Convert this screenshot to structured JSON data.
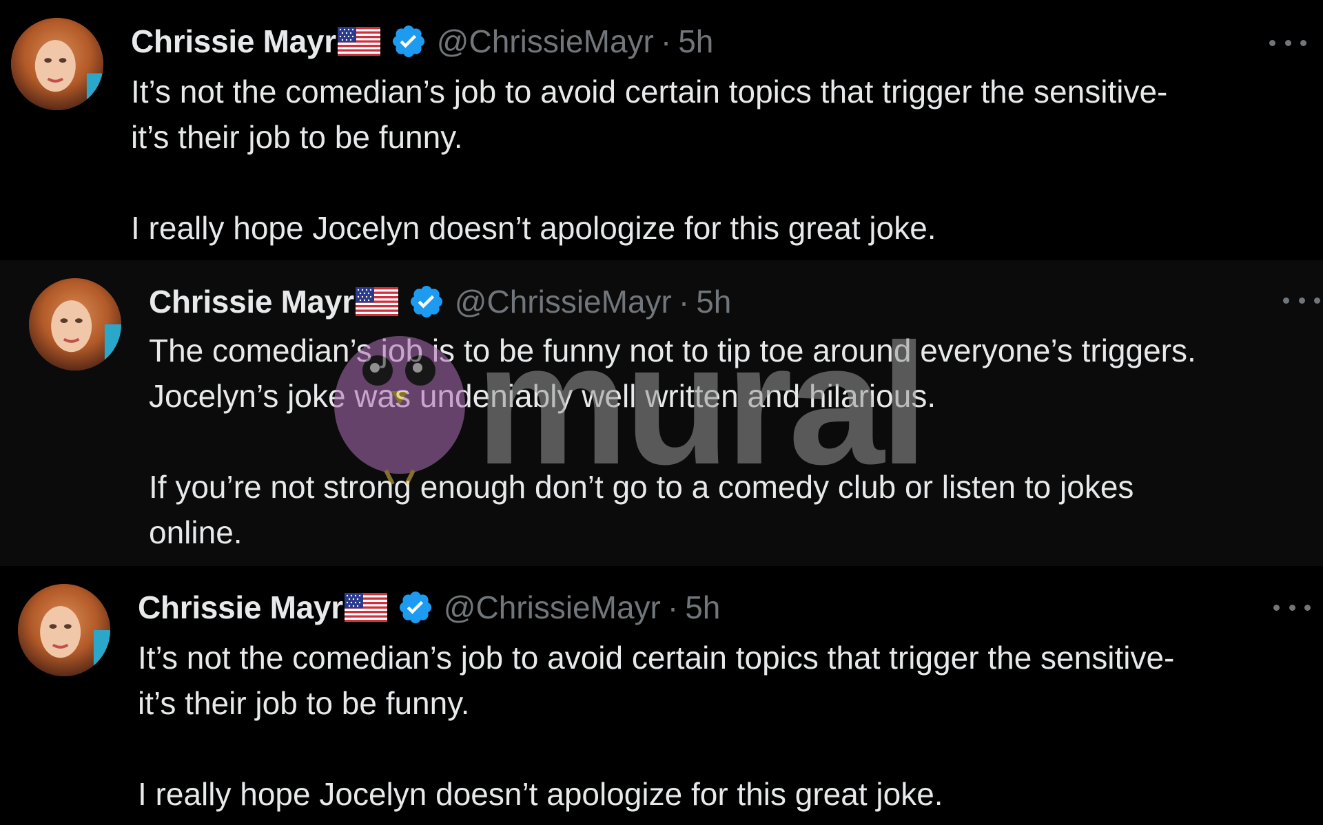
{
  "tweets": [
    {
      "display_name": "Chrissie Mayr",
      "flag_icon": "us-flag-icon",
      "verified_icon": "verified-badge-icon",
      "handle": "@ChrissieMayr",
      "separator": "·",
      "time": "5h",
      "body_lines": [
        "It’s not the comedian’s job to avoid certain topics that trigger the sensitive-",
        "it’s their job to be funny.",
        "",
        "I really hope Jocelyn doesn’t apologize for this great joke."
      ]
    },
    {
      "display_name": "Chrissie Mayr",
      "flag_icon": "us-flag-icon",
      "verified_icon": "verified-badge-icon",
      "handle": "@ChrissieMayr",
      "separator": "·",
      "time": "5h",
      "body_lines": [
        "The comedian’s job is to be funny not to tip toe around everyone’s triggers.",
        "Jocelyn’s joke was undeniably well written and hilarious.",
        "",
        "If you’re not strong enough don’t go to a comedy club or listen to jokes",
        "online."
      ]
    },
    {
      "display_name": "Chrissie Mayr",
      "flag_icon": "us-flag-icon",
      "verified_icon": "verified-badge-icon",
      "handle": "@ChrissieMayr",
      "separator": "·",
      "time": "5h",
      "body_lines": [
        "It’s not the comedian’s job to avoid certain topics that trigger the sensitive-",
        "it’s their job to be funny.",
        "",
        "I really hope Jocelyn doesn’t apologize for this great joke."
      ]
    }
  ],
  "watermark": {
    "text": "mural",
    "icon": "owl-mascot-icon"
  },
  "colors": {
    "background": "#000000",
    "text_primary": "#e7e9ea",
    "text_secondary": "#71767b",
    "verified_blue": "#1d9bf0",
    "watermark_purple": "#b06fb6"
  }
}
